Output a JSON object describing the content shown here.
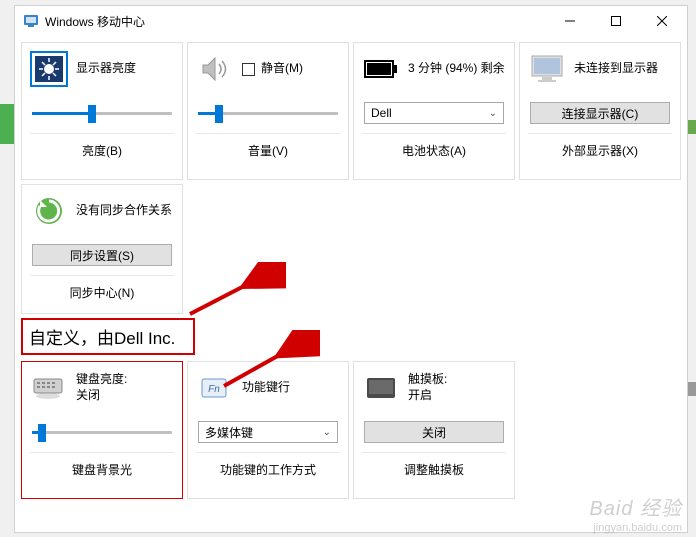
{
  "window": {
    "title": "Windows 移动中心"
  },
  "tiles": {
    "brightness": {
      "label": "显示器亮度",
      "footer": "亮度(B)",
      "value_pct": 40
    },
    "volume": {
      "mute_label": "静音(M)",
      "footer": "音量(V)",
      "value_pct": 12
    },
    "battery": {
      "status": "3 分钟 (94%) 剩余",
      "dropdown": "Dell",
      "footer": "电池状态(A)"
    },
    "display": {
      "label": "未连接到显示器",
      "button": "连接显示器(C)",
      "footer": "外部显示器(X)"
    },
    "sync": {
      "label": "没有同步合作关系",
      "button": "同步设置(S)",
      "footer": "同步中心(N)"
    },
    "keyboard": {
      "label_line1": "键盘亮度:",
      "label_line2": "关闭",
      "footer": "键盘背景光",
      "value_pct": 4
    },
    "fnkeys": {
      "label": "功能键行",
      "dropdown": "多媒体键",
      "footer": "功能键的工作方式"
    },
    "touchpad": {
      "label_line1": "触摸板:",
      "label_line2": "开启",
      "button": "关闭",
      "footer": "调整触摸板"
    }
  },
  "custom_header": "自定义，由Dell Inc.",
  "watermark": {
    "main": "Baid 经验",
    "sub": "jingyan.baidu.com"
  }
}
